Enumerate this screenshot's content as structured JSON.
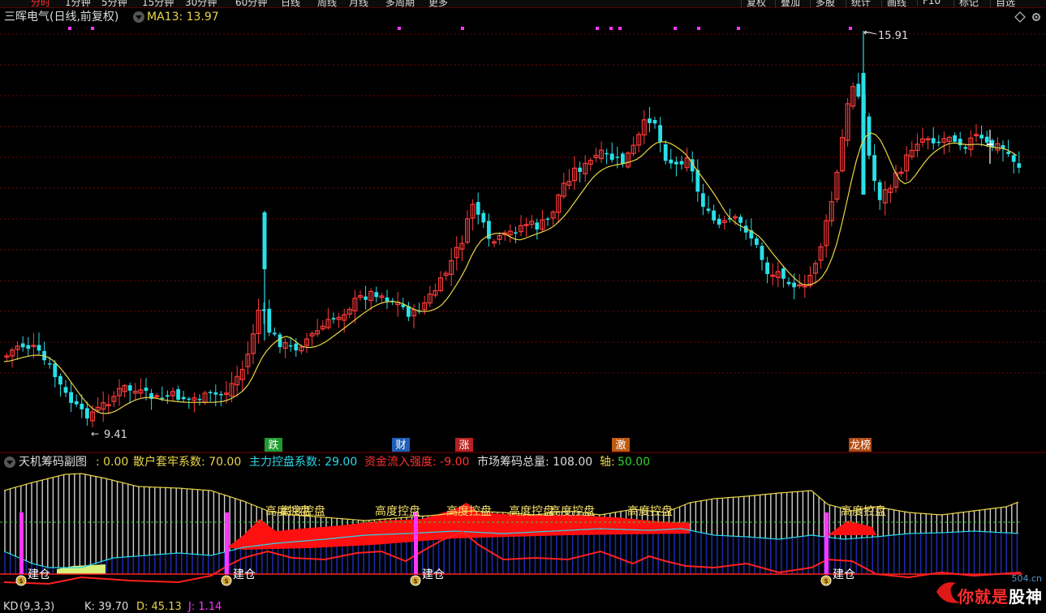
{
  "topbar": {
    "tabs": [
      "分时",
      "1分钟",
      "5分钟",
      "15分钟",
      "30分钟",
      "60分钟",
      "日线",
      "周线",
      "月线",
      "多周期",
      "更多"
    ],
    "right_tabs": [
      "复权",
      "叠加",
      "多股",
      "统计",
      "画线",
      "F10",
      "标记",
      "自选"
    ]
  },
  "header": {
    "stock": "三晖电气(日线,前复权)",
    "ma": "MA13: 13.97"
  },
  "main_chart": {
    "high_label": "15.91",
    "low_label": "9.41",
    "markers": [
      {
        "text": "跌",
        "color": "#1f9a2f"
      },
      {
        "text": "财",
        "color": "#1e5fb8"
      },
      {
        "text": "涨",
        "color": "#b82020"
      },
      {
        "text": "激",
        "color": "#c05a10"
      },
      {
        "text": "龙榜",
        "color": "#b04a10"
      }
    ]
  },
  "sub_header": {
    "title": "天机筹码副图",
    "v0": ": 0.00",
    "f1": "散户套牢系数: 70.00",
    "f2": "主力控盘系数: 29.00",
    "f3": "资金流入强度: -9.00",
    "f4": "市场筹码总量: 108.00",
    "f5_label": "轴:",
    "f5_value": "50.00"
  },
  "sub_chart": {
    "control_label": "高度控盘",
    "build_label": "建仓"
  },
  "kdj": {
    "name": "KD",
    "params": "(9,3,3)",
    "k": "K: 39.70",
    "d": "D: 45.13",
    "j": "J: 1.14"
  },
  "watermark": {
    "a": "你就是",
    "b": "股神",
    "url": "504.cn"
  },
  "colors": {
    "up": "#ff3c3c",
    "down": "#29e0e8",
    "ma": "#e8d548",
    "purple": "#ff36ff",
    "grid": "#7a0000"
  }
}
